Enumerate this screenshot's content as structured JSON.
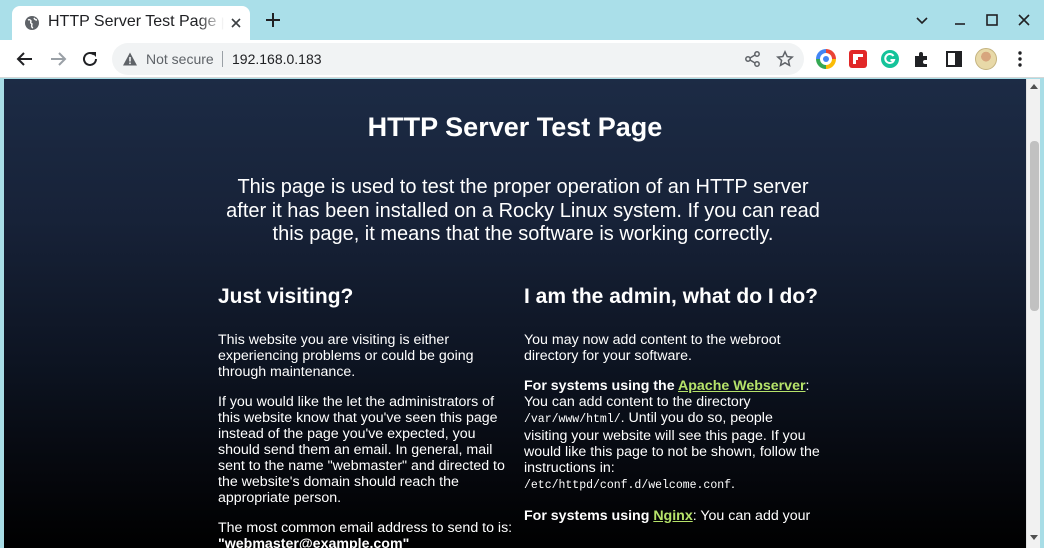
{
  "browser": {
    "tab_title": "HTTP Server Test Page powered by: Rocky Linux",
    "security_label": "Not secure",
    "url": "192.168.0.183"
  },
  "page": {
    "title": "HTTP Server Test Page",
    "intro": "This page is used to test the proper operation of an HTTP server after it has been installed on a Rocky Linux system. If you can read this page, it means that the software is working correctly.",
    "visiting": {
      "heading": "Just visiting?",
      "p1": "This website you are visiting is either experiencing problems or could be going through maintenance.",
      "p2": "If you would like the let the administrators of this website know that you've seen this page instead of the page you've expected, you should send them an email. In general, mail sent to the name \"webmaster\" and directed to the website's domain should reach the appropriate person.",
      "p3_prefix": "The most common email address to send to is: ",
      "p3_email": "\"webmaster@example.com\""
    },
    "admin": {
      "heading": "I am the admin, what do I do?",
      "p1": "You may now add content to the webroot directory for your software.",
      "apache_prefix": "For systems using the ",
      "apache_link": "Apache Webserver",
      "apache_text1": ": You can add content to the directory ",
      "apache_path": "/var/www/html/",
      "apache_text2": ". Until you do so, people visiting your website will see this page. If you would like this page to not be shown, follow the instructions in: ",
      "apache_conf": "/etc/httpd/conf.d/welcome.conf",
      "apache_end": ".",
      "nginx_prefix": "For systems using ",
      "nginx_link": "Nginx",
      "nginx_text": ": You can add your"
    }
  }
}
